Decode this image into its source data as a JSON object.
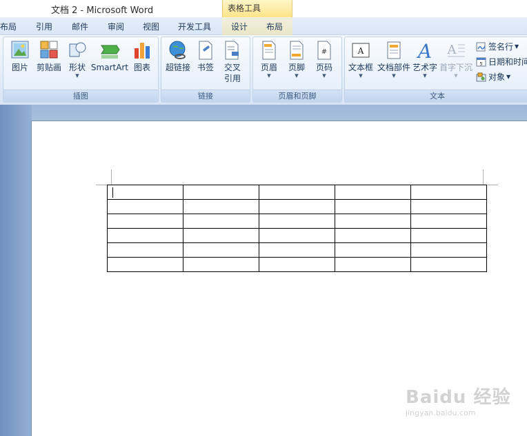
{
  "window": {
    "title": "文档 2 - Microsoft Word",
    "contextual_tab_group": "表格工具"
  },
  "tabs": [
    "布局",
    "引用",
    "邮件",
    "审阅",
    "视图",
    "开发工具",
    "设计",
    "布局"
  ],
  "ribbon": {
    "groups": {
      "illustrations": {
        "label": "插图",
        "buttons": {
          "picture": "图片",
          "clipart": "剪贴画",
          "shapes": "形状",
          "smartart": "SmartArt",
          "chart": "图表"
        }
      },
      "links": {
        "label": "链接",
        "buttons": {
          "hyperlink": "超链接",
          "bookmark": "书签",
          "crossref_line1": "交叉",
          "crossref_line2": "引用"
        }
      },
      "header_footer": {
        "label": "页眉和页脚",
        "buttons": {
          "header": "页眉",
          "footer": "页脚",
          "page_number": "页码"
        }
      },
      "text": {
        "label": "文本",
        "buttons": {
          "textbox": "文本框",
          "quickparts": "文档部件",
          "wordart": "艺术字",
          "dropcap": "首字下沉",
          "signature": "签名行",
          "datetime": "日期和时间",
          "object": "对象"
        }
      }
    }
  },
  "document": {
    "table": {
      "rows": 6,
      "cols": 5
    }
  },
  "watermark": {
    "main": "Baidu 经验",
    "sub": "jingyan.baidu.com"
  },
  "colors": {
    "ribbon_text": "#1e395b",
    "contextual_tab": "#fde48a",
    "page": "#ffffff"
  }
}
